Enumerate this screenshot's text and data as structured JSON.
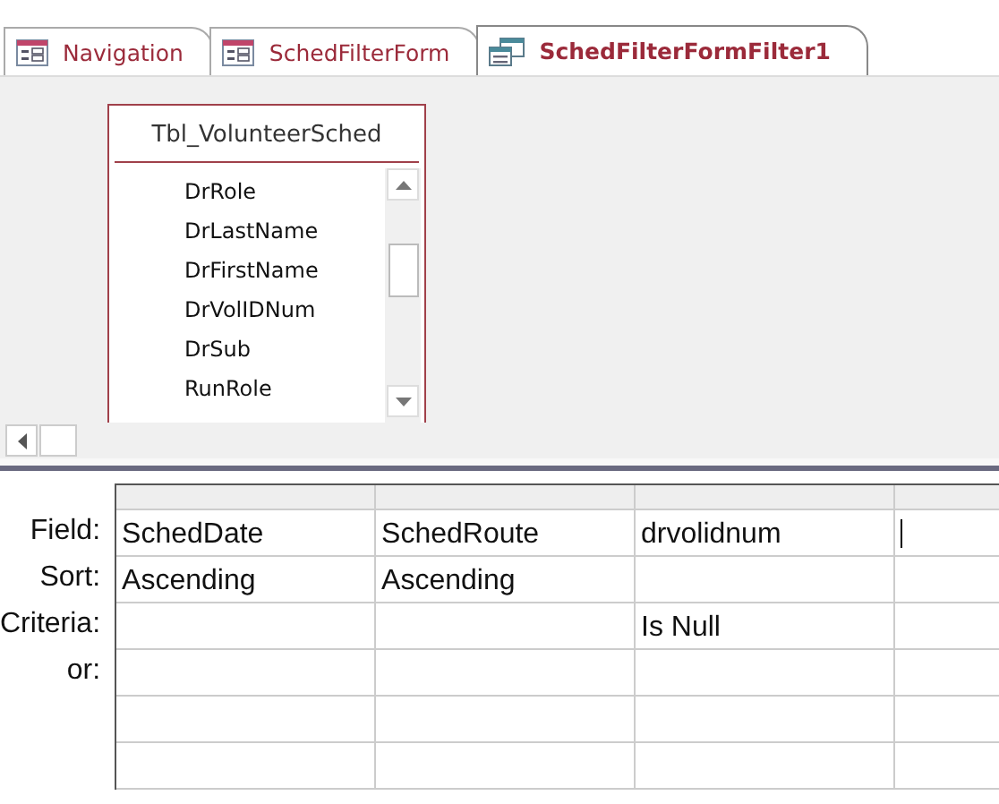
{
  "tabs": [
    {
      "label": "Navigation",
      "kind": "form",
      "selected": false
    },
    {
      "label": "SchedFilterForm",
      "kind": "form",
      "selected": false
    },
    {
      "label": "SchedFilterFormFilter1",
      "kind": "query",
      "selected": true
    }
  ],
  "table_box": {
    "title": "Tbl_VolunteerSched",
    "fields": [
      "DrRole",
      "DrLastName",
      "DrFirstName",
      "DrVolIDNum",
      "DrSub",
      "RunRole"
    ]
  },
  "grid": {
    "row_labels": [
      "Field:",
      "Sort:",
      "Criteria:",
      "or:"
    ],
    "columns": [
      {
        "field": "SchedDate",
        "sort": "Ascending"
      },
      {
        "field": "SchedRoute",
        "sort": "Ascending"
      },
      {
        "field": "drvolidnum",
        "criteria": "Is Null"
      },
      {
        "focused": true
      }
    ]
  }
}
